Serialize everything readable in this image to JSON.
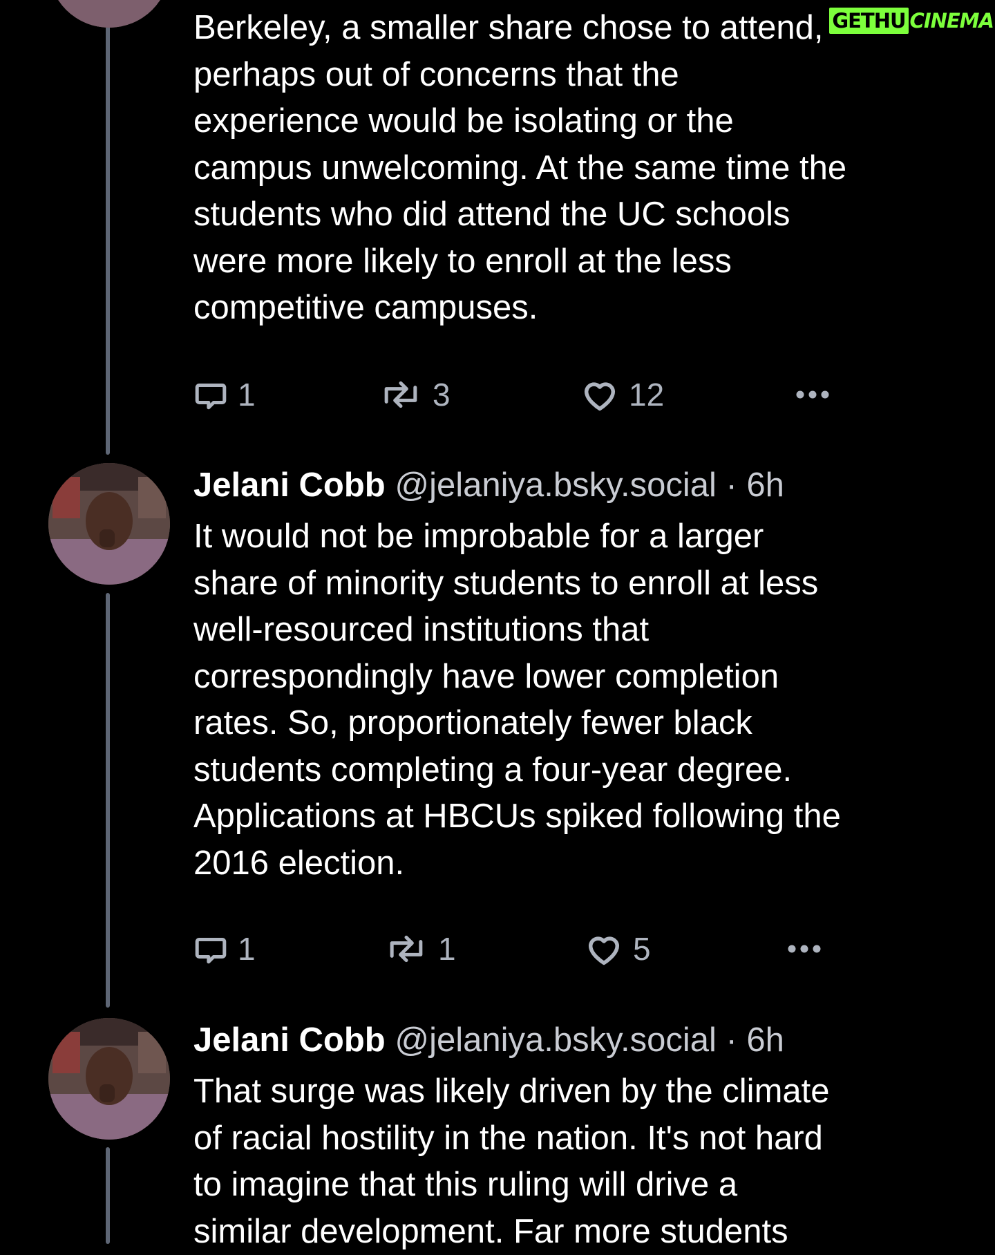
{
  "watermark": {
    "boxed": "GETHU",
    "text": "CINEMA",
    "color": "#7dff3c"
  },
  "colors": {
    "background": "#000000",
    "thread_line": "#5e6675",
    "secondary_text": "#c9ccd3",
    "action_icon": "#aeb4bf"
  },
  "posts": [
    {
      "text": "Berkeley, a smaller share chose to attend,\nperhaps out of concerns that the\nexperience would be isolating or the\ncampus unwelcoming. At the same time the\nstudents who did attend the UC schools\nwere more likely to enroll at the less\ncompetitive campuses.",
      "actions": {
        "replies": "1",
        "reposts": "3",
        "likes": "12"
      }
    },
    {
      "author": "Jelani Cobb",
      "handle": "@jelaniya.bsky.social",
      "time": "· 6h",
      "text": "It would not be improbable for a larger\nshare of minority students to enroll at less\nwell-resourced institutions that\ncorrespondingly have lower completion\nrates. So, proportionately fewer black\nstudents completing a four-year degree.\nApplications at HBCUs spiked following the\n2016 election.",
      "actions": {
        "replies": "1",
        "reposts": "1",
        "likes": "5"
      }
    },
    {
      "author": "Jelani Cobb",
      "handle": "@jelaniya.bsky.social",
      "time": "· 6h",
      "text": "That surge was likely driven by the climate\nof racial hostility in the nation. It's not hard\nto imagine that this ruling will drive a\nsimilar development. Far more students"
    }
  ],
  "icons": {
    "reply": "speech-bubble-icon",
    "repost": "repost-arrows-icon",
    "like": "heart-icon",
    "more": "ellipsis-icon",
    "avatar": "profile-photo"
  }
}
